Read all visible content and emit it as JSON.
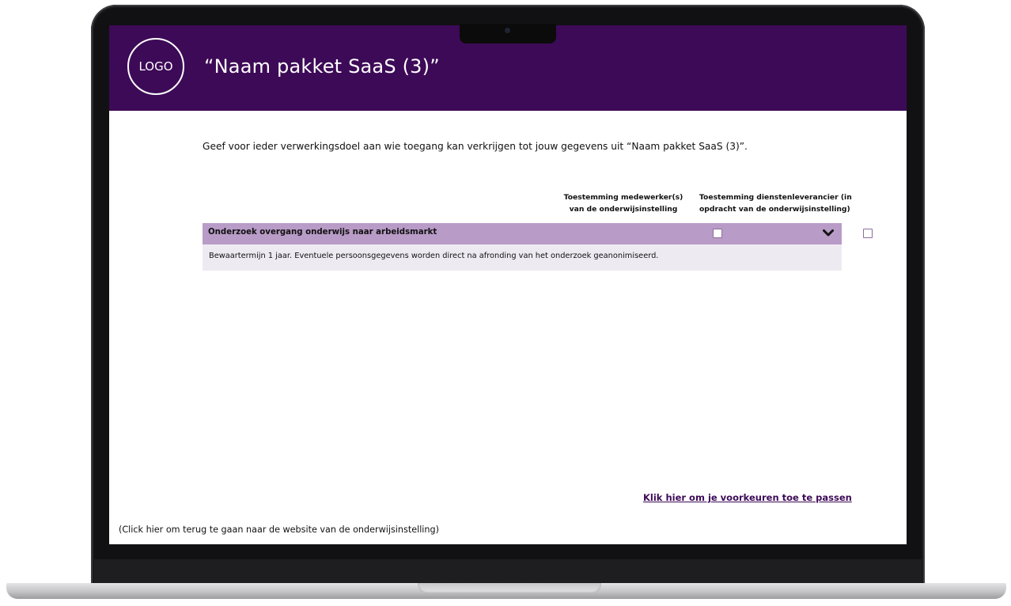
{
  "header": {
    "logo_text": "LOGO",
    "title": "“Naam pakket SaaS (3)”",
    "background_color": "#3d0a57"
  },
  "intro": {
    "text": "Geef voor ieder verwerkingsdoel aan wie toegang kan verkrijgen tot jouw gegevens uit “Naam pakket SaaS (3)”."
  },
  "columns": [
    {
      "line1": "Toestemming medewerker(s)",
      "line2": "van de onderwijsinstelling"
    },
    {
      "line1": "Toestemming dienstenleverancier (in",
      "line2": "opdracht van de onderwijsinstelling)"
    }
  ],
  "purposes": [
    {
      "label": "Onderzoek overgang onderwijs naar arbeidsmarkt",
      "consent_employee": false,
      "consent_supplier": false,
      "expanded": true,
      "detail": "Bewaartermijn 1 jaar. Eventuele persoonsgegevens worden direct na afronding van het onderzoek geanonimiseerd.",
      "row_color": "#b99bc7",
      "detail_color": "#eeeaf2",
      "icon": "chevron-down-icon"
    }
  ],
  "links": {
    "preferences": "Klik hier om je voorkeuren toe te passen",
    "back": "(Click hier om terug te gaan naar de website van de onderwijsinstelling)"
  }
}
